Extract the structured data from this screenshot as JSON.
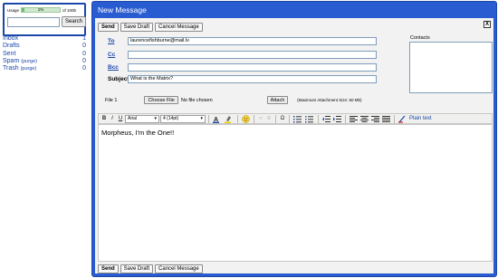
{
  "sidebar": {
    "usage_label": "Usage",
    "usage_percent": "1%",
    "usage_fraction": 0.01,
    "usage_total": "of 100b",
    "search_button": "Search",
    "folders": [
      {
        "name": "Inbox",
        "count": "1",
        "purge": ""
      },
      {
        "name": "Drafts",
        "count": "0",
        "purge": ""
      },
      {
        "name": "Sent",
        "count": "0",
        "purge": ""
      },
      {
        "name": "Spam",
        "count": "0",
        "purge": "(purge)"
      },
      {
        "name": "Trash",
        "count": "0",
        "purge": "(purge)"
      }
    ]
  },
  "window": {
    "title": "New Message",
    "close": "X"
  },
  "toolbar": {
    "send": "Send",
    "save_draft": "Save Draft",
    "cancel": "Cancel Message"
  },
  "compose": {
    "to_label": "To",
    "to_value": "laurencefishburne@mail.lv",
    "cc_label": "Cc",
    "cc_value": "",
    "bcc_label": "Bcc",
    "bcc_value": "",
    "subject_label": "Subject",
    "subject_value": "What is the Matrix?",
    "contacts_label": "Contacts"
  },
  "attachment": {
    "file_label": "File 1",
    "choose_button": "Choose File",
    "no_file": "No file chosen",
    "attach_button": "Attach",
    "max_size": "(Maximum Attachment Size: 50 Mb)"
  },
  "editor": {
    "bold": "B",
    "italic": "I",
    "underline": "U",
    "font_name": "Arial",
    "font_size": "4 (14pt)",
    "omega": "Ω",
    "plain_text": "Plain text",
    "body": "Morpheus, I'm the One!!"
  }
}
